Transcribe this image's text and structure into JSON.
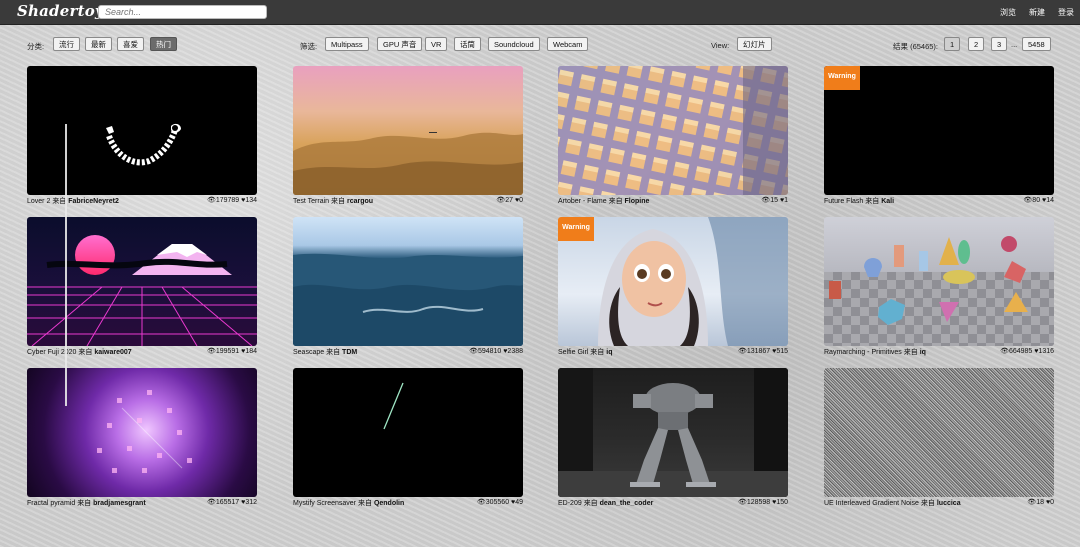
{
  "header": {
    "logo": "Shadertoy",
    "search_placeholder": "Search...",
    "nav": [
      "浏览",
      "新建",
      "登录"
    ]
  },
  "filters": {
    "sort_label": "分类:",
    "sort_options": [
      "流行",
      "最新",
      "喜爱",
      "热门"
    ],
    "active_sort": "热门",
    "filter_label": "筛选:",
    "filter_options": [
      "Multipass",
      "GPU 声音",
      "VR",
      "话筒",
      "Soundcloud",
      "Webcam"
    ],
    "view_label": "View:",
    "view_option": "幻灯片",
    "results_label": "结果 (65465):",
    "pages": [
      "1",
      "2",
      "3",
      "...",
      "5458"
    ]
  },
  "shaders": [
    {
      "title": "Lover 2",
      "by": "来自",
      "author": "FabriceNeyret2",
      "views": "179789",
      "likes": "134",
      "warning": ""
    },
    {
      "title": "Test Terrain",
      "by": "来自",
      "author": "rcargou",
      "views": "27",
      "likes": "0",
      "warning": ""
    },
    {
      "title": "Artober - Flame",
      "by": "来自",
      "author": "Flopine",
      "views": "15",
      "likes": "1",
      "warning": ""
    },
    {
      "title": "Future Flash",
      "by": "来自",
      "author": "Kali",
      "views": "80",
      "likes": "14",
      "warning": "Warning"
    },
    {
      "title": "Cyber Fuji 2020",
      "by": "来自",
      "author": "kaiware007",
      "views": "199591",
      "likes": "184",
      "warning": ""
    },
    {
      "title": "Seascape",
      "by": "来自",
      "author": "TDM",
      "views": "594810",
      "likes": "2388",
      "warning": ""
    },
    {
      "title": "Selfie Girl",
      "by": "来自",
      "author": "iq",
      "views": "131867",
      "likes": "515",
      "warning": "Warning"
    },
    {
      "title": "Raymarching - Primitives",
      "by": "来自",
      "author": "iq",
      "views": "664985",
      "likes": "1316",
      "warning": ""
    },
    {
      "title": "Fractal pyramid",
      "by": "来自",
      "author": "bradjamesgrant",
      "views": "165517",
      "likes": "312",
      "warning": ""
    },
    {
      "title": "Mystify Screensaver",
      "by": "来自",
      "author": "Qendolin",
      "views": "305560",
      "likes": "49",
      "warning": ""
    },
    {
      "title": "ED-209",
      "by": "来自",
      "author": "dean_the_coder",
      "views": "128598",
      "likes": "150",
      "warning": ""
    },
    {
      "title": "UE Interleaved Gradient Noise",
      "by": "来自",
      "author": "luccica",
      "views": "18",
      "likes": "0",
      "warning": ""
    }
  ]
}
